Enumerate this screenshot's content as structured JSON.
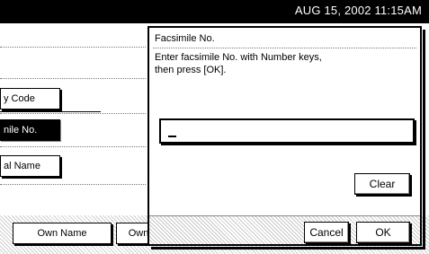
{
  "status_bar": {
    "datetime": "AUG 15, 2002 11:15AM"
  },
  "background_screen": {
    "buttons": [
      {
        "label": "y Code",
        "selected": false
      },
      {
        "label": "nile No.",
        "selected": true
      },
      {
        "label": "al Name",
        "selected": false
      }
    ],
    "bottom_buttons": [
      "Own Name",
      "Own"
    ]
  },
  "dialog": {
    "title": "Facsimile No.",
    "message_line1": "Enter facsimile No. with Number keys,",
    "message_line2": "then press [OK].",
    "input_value": "",
    "clear_label": "Clear",
    "cancel_label": "Cancel",
    "ok_label": "OK"
  }
}
